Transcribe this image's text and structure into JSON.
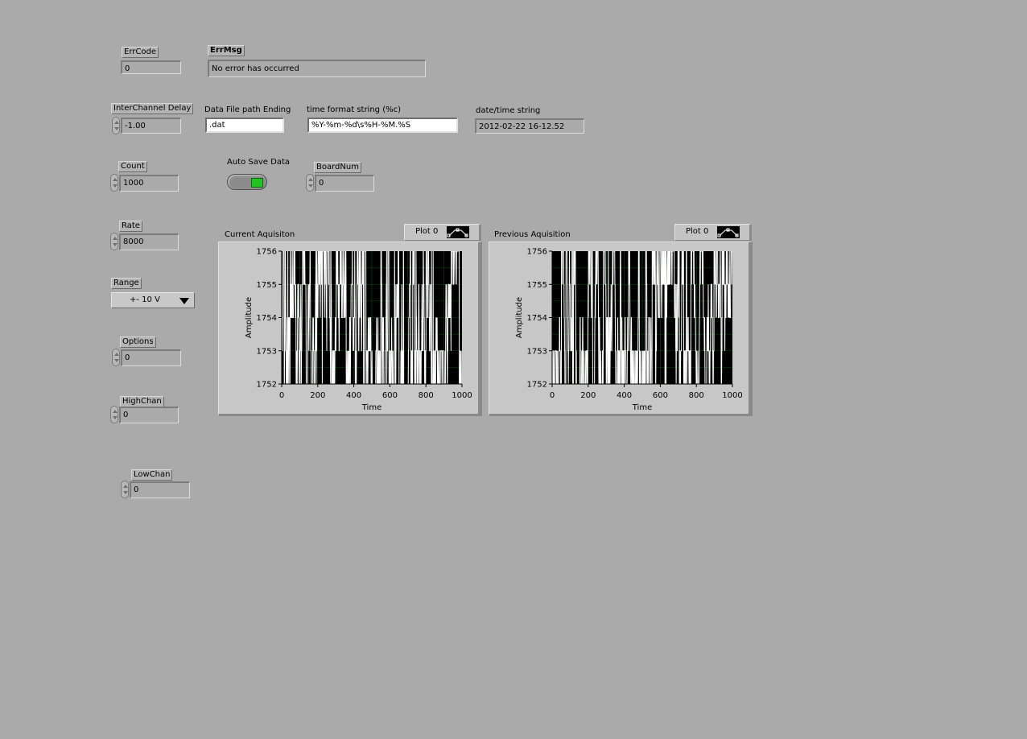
{
  "err_code": {
    "label": "ErrCode",
    "value": "0"
  },
  "err_msg": {
    "label": "ErrMsg",
    "value": "No error has occurred"
  },
  "interchannel_delay": {
    "label": "InterChannel Delay",
    "value": "-1.00"
  },
  "data_file_ending": {
    "label": "Data File path Ending",
    "value": ".dat"
  },
  "time_format": {
    "label": "time format string (%c)",
    "value": "%Y-%m-%d\\s%H-%M.%S"
  },
  "datetime_string": {
    "label": "date/time string",
    "value": "2012-02-22 16-12.52"
  },
  "count": {
    "label": "Count",
    "value": "1000"
  },
  "auto_save": {
    "label": "Auto Save Data",
    "on": true
  },
  "board_num": {
    "label": "BoardNum",
    "value": "0"
  },
  "rate": {
    "label": "Rate",
    "value": "8000"
  },
  "range": {
    "label": "Range",
    "value": "+- 10 V"
  },
  "options": {
    "label": "Options",
    "value": "0"
  },
  "high_chan": {
    "label": "HighChan",
    "value": "0"
  },
  "low_chan": {
    "label": "LowChan",
    "value": "0"
  },
  "colors": {
    "background": "#aaaaaa",
    "plot_bg": "#000000",
    "grid": "#0e4a0e",
    "trace": "#ffffff",
    "led_on": "#22c322"
  },
  "chart_data": [
    {
      "type": "line",
      "title": "Current Aquisiton",
      "legend": "Plot 0",
      "xlabel": "Time",
      "ylabel": "Amplitude",
      "xlim": [
        0,
        1000
      ],
      "ylim": [
        1752,
        1756
      ],
      "x_ticks": [
        "0",
        "200",
        "400",
        "600",
        "800",
        "1000"
      ],
      "y_ticks": [
        "1752",
        "1753",
        "1754",
        "1755",
        "1756"
      ],
      "grid": true,
      "series": [
        {
          "description": "noisy integer ADC trace toggling between 1752 and 1756",
          "levels": [
            1752,
            1753,
            1754,
            1755,
            1756
          ],
          "points": 1000
        }
      ]
    },
    {
      "type": "line",
      "title": "Previous Aquisition",
      "legend": "Plot 0",
      "xlabel": "Time",
      "ylabel": "Amplitude",
      "xlim": [
        0,
        1000
      ],
      "ylim": [
        1752,
        1756
      ],
      "x_ticks": [
        "0",
        "200",
        "400",
        "600",
        "800",
        "1000"
      ],
      "y_ticks": [
        "1752",
        "1753",
        "1754",
        "1755",
        "1756"
      ],
      "grid": true,
      "series": [
        {
          "description": "noisy integer ADC trace toggling between 1752 and 1756",
          "levels": [
            1752,
            1753,
            1754,
            1755,
            1756
          ],
          "points": 1000
        }
      ]
    }
  ]
}
